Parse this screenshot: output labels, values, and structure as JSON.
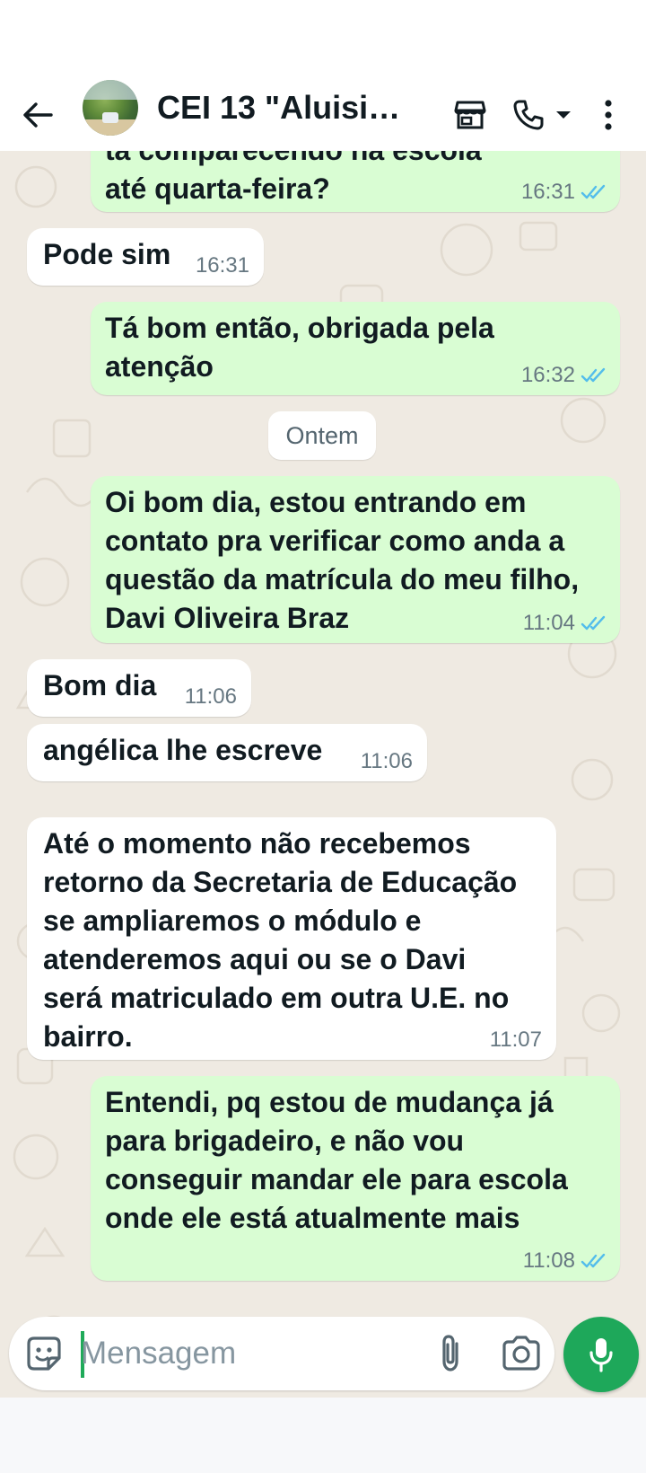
{
  "header": {
    "title": "CEI 13 \"Aluisio...",
    "icons": [
      "back-arrow-icon",
      "store-icon",
      "phone-icon",
      "chevron-down-icon",
      "more-vert-icon"
    ]
  },
  "messages": {
    "m1": {
      "text": "tá comparecendo na escola até quarta-feira?",
      "time": "16:31"
    },
    "m2": {
      "text": "Pode sim",
      "time": "16:31"
    },
    "m3": {
      "text": "Tá bom então, obrigada pela atenção",
      "time": "16:32"
    },
    "date_divider": "Ontem",
    "m4": {
      "text": "Oi bom dia, estou entrando em contato pra verificar como anda a questão da matrícula do meu filho, Davi Oliveira Braz",
      "time": "11:04"
    },
    "m5": {
      "text": "Bom dia",
      "time": "11:06"
    },
    "m6": {
      "text": "angélica lhe escreve",
      "time": "11:06"
    },
    "m7": {
      "text": "Até o momento não recebemos retorno da Secretaria de Educação se ampliaremos o módulo e atenderemos aqui ou se o Davi será matriculado em outra U.E. no bairro.",
      "time": "11:07"
    },
    "m8": {
      "text": "Entendi, pq estou de mudança já para brigadeiro, e não vou conseguir mandar ele para escola onde ele está atualmente mais",
      "time": "11:08"
    }
  },
  "composer": {
    "placeholder": "Mensagem"
  },
  "colors": {
    "outgoing_bubble": "#d9fdd3",
    "incoming_bubble": "#ffffff",
    "chat_background": "#efeae2",
    "read_ticks": "#53bdeb",
    "accent_green": "#1ea85a"
  }
}
